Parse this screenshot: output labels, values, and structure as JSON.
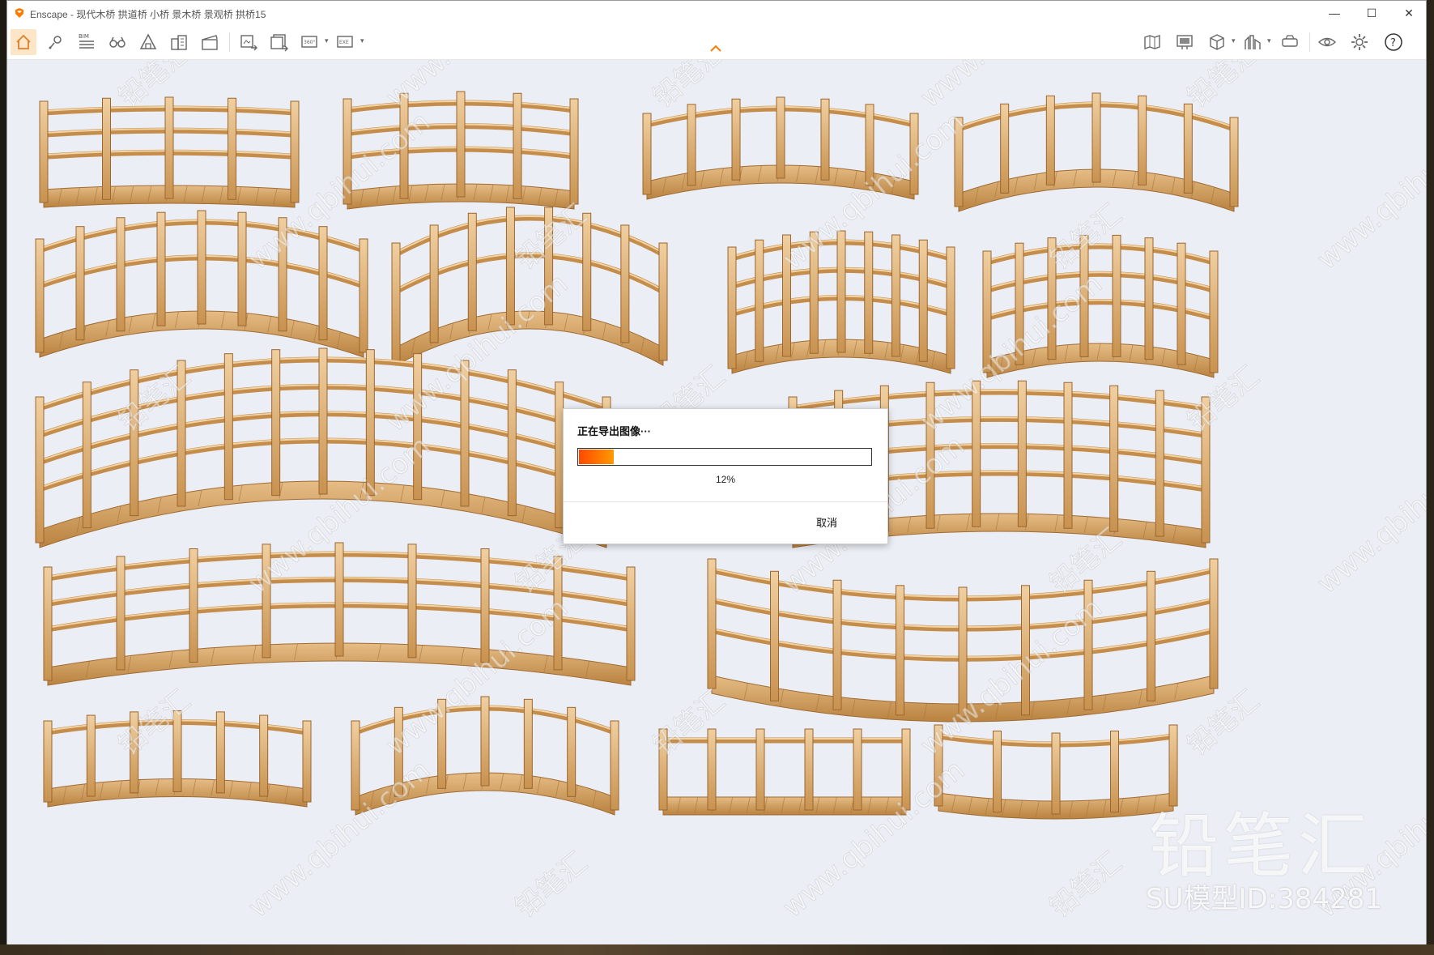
{
  "window": {
    "title": "Enscape - 现代木桥 拱道桥 小桥 景木桥 景观桥 拱桥15",
    "minimize_label": "—",
    "maximize_label": "☐",
    "close_label": "✕"
  },
  "toolbar": {
    "items": [
      {
        "name": "home",
        "icon": "home-icon"
      },
      {
        "name": "views",
        "icon": "location-pin-icon"
      },
      {
        "name": "bim",
        "icon": "bim-list-icon",
        "label": "BIM"
      },
      {
        "name": "binoculars",
        "icon": "binoculars-icon"
      },
      {
        "name": "atmosphere",
        "icon": "triangle-building-icon"
      },
      {
        "name": "asset-library",
        "icon": "buildings-icon"
      },
      {
        "name": "video-editor",
        "icon": "clapperboard-icon"
      },
      {
        "name": "screenshot",
        "icon": "export-image-icon"
      },
      {
        "name": "batch-render",
        "icon": "batch-render-icon"
      },
      {
        "name": "panorama",
        "icon": "panorama-icon",
        "label": "360°"
      },
      {
        "name": "exe-export",
        "icon": "exe-export-icon",
        "label": "EXE"
      },
      {
        "name": "map",
        "icon": "map-icon"
      },
      {
        "name": "billboard",
        "icon": "billboard-icon"
      },
      {
        "name": "cube",
        "icon": "cube-icon"
      },
      {
        "name": "city",
        "icon": "city-icon"
      },
      {
        "name": "vr-headset",
        "icon": "vr-headset-icon"
      },
      {
        "name": "visibility",
        "icon": "eye-icon"
      },
      {
        "name": "settings",
        "icon": "gear-icon"
      },
      {
        "name": "help",
        "icon": "help-icon",
        "label": "?"
      }
    ]
  },
  "watermark": {
    "logo_text": "铅笔汇",
    "id_text": "SU模型ID:384281",
    "tiled_text": "www.qbihui.com",
    "tiled_logo": "铅笔汇"
  },
  "dialog": {
    "title": "正在导出图像···",
    "progress": 0.12,
    "percent_text": "12%",
    "cancel_label": "取消"
  },
  "colors": {
    "accent": "#ff6a00",
    "viewport_bg": "#ebeef5",
    "wood": "#d9a86a",
    "wood_dark": "#b07a40",
    "wood_light": "#f0cfa0"
  }
}
